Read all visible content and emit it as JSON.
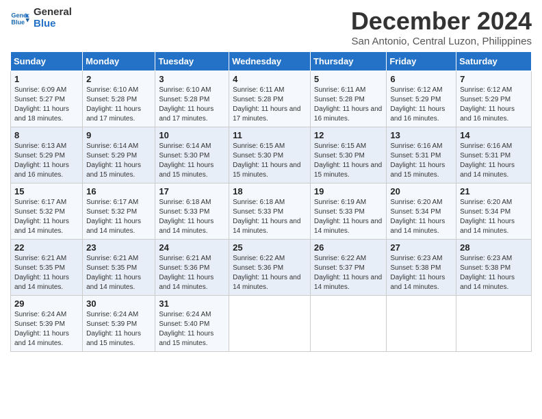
{
  "logo": {
    "line1": "General",
    "line2": "Blue"
  },
  "title": "December 2024",
  "subtitle": "San Antonio, Central Luzon, Philippines",
  "days_of_week": [
    "Sunday",
    "Monday",
    "Tuesday",
    "Wednesday",
    "Thursday",
    "Friday",
    "Saturday"
  ],
  "weeks": [
    [
      {
        "day": "1",
        "sunrise": "6:09 AM",
        "sunset": "5:27 PM",
        "daylight": "11 hours and 18 minutes."
      },
      {
        "day": "2",
        "sunrise": "6:10 AM",
        "sunset": "5:28 PM",
        "daylight": "11 hours and 17 minutes."
      },
      {
        "day": "3",
        "sunrise": "6:10 AM",
        "sunset": "5:28 PM",
        "daylight": "11 hours and 17 minutes."
      },
      {
        "day": "4",
        "sunrise": "6:11 AM",
        "sunset": "5:28 PM",
        "daylight": "11 hours and 17 minutes."
      },
      {
        "day": "5",
        "sunrise": "6:11 AM",
        "sunset": "5:28 PM",
        "daylight": "11 hours and 16 minutes."
      },
      {
        "day": "6",
        "sunrise": "6:12 AM",
        "sunset": "5:29 PM",
        "daylight": "11 hours and 16 minutes."
      },
      {
        "day": "7",
        "sunrise": "6:12 AM",
        "sunset": "5:29 PM",
        "daylight": "11 hours and 16 minutes."
      }
    ],
    [
      {
        "day": "8",
        "sunrise": "6:13 AM",
        "sunset": "5:29 PM",
        "daylight": "11 hours and 16 minutes."
      },
      {
        "day": "9",
        "sunrise": "6:14 AM",
        "sunset": "5:29 PM",
        "daylight": "11 hours and 15 minutes."
      },
      {
        "day": "10",
        "sunrise": "6:14 AM",
        "sunset": "5:30 PM",
        "daylight": "11 hours and 15 minutes."
      },
      {
        "day": "11",
        "sunrise": "6:15 AM",
        "sunset": "5:30 PM",
        "daylight": "11 hours and 15 minutes."
      },
      {
        "day": "12",
        "sunrise": "6:15 AM",
        "sunset": "5:30 PM",
        "daylight": "11 hours and 15 minutes."
      },
      {
        "day": "13",
        "sunrise": "6:16 AM",
        "sunset": "5:31 PM",
        "daylight": "11 hours and 15 minutes."
      },
      {
        "day": "14",
        "sunrise": "6:16 AM",
        "sunset": "5:31 PM",
        "daylight": "11 hours and 14 minutes."
      }
    ],
    [
      {
        "day": "15",
        "sunrise": "6:17 AM",
        "sunset": "5:32 PM",
        "daylight": "11 hours and 14 minutes."
      },
      {
        "day": "16",
        "sunrise": "6:17 AM",
        "sunset": "5:32 PM",
        "daylight": "11 hours and 14 minutes."
      },
      {
        "day": "17",
        "sunrise": "6:18 AM",
        "sunset": "5:33 PM",
        "daylight": "11 hours and 14 minutes."
      },
      {
        "day": "18",
        "sunrise": "6:18 AM",
        "sunset": "5:33 PM",
        "daylight": "11 hours and 14 minutes."
      },
      {
        "day": "19",
        "sunrise": "6:19 AM",
        "sunset": "5:33 PM",
        "daylight": "11 hours and 14 minutes."
      },
      {
        "day": "20",
        "sunrise": "6:20 AM",
        "sunset": "5:34 PM",
        "daylight": "11 hours and 14 minutes."
      },
      {
        "day": "21",
        "sunrise": "6:20 AM",
        "sunset": "5:34 PM",
        "daylight": "11 hours and 14 minutes."
      }
    ],
    [
      {
        "day": "22",
        "sunrise": "6:21 AM",
        "sunset": "5:35 PM",
        "daylight": "11 hours and 14 minutes."
      },
      {
        "day": "23",
        "sunrise": "6:21 AM",
        "sunset": "5:35 PM",
        "daylight": "11 hours and 14 minutes."
      },
      {
        "day": "24",
        "sunrise": "6:21 AM",
        "sunset": "5:36 PM",
        "daylight": "11 hours and 14 minutes."
      },
      {
        "day": "25",
        "sunrise": "6:22 AM",
        "sunset": "5:36 PM",
        "daylight": "11 hours and 14 minutes."
      },
      {
        "day": "26",
        "sunrise": "6:22 AM",
        "sunset": "5:37 PM",
        "daylight": "11 hours and 14 minutes."
      },
      {
        "day": "27",
        "sunrise": "6:23 AM",
        "sunset": "5:38 PM",
        "daylight": "11 hours and 14 minutes."
      },
      {
        "day": "28",
        "sunrise": "6:23 AM",
        "sunset": "5:38 PM",
        "daylight": "11 hours and 14 minutes."
      }
    ],
    [
      {
        "day": "29",
        "sunrise": "6:24 AM",
        "sunset": "5:39 PM",
        "daylight": "11 hours and 14 minutes."
      },
      {
        "day": "30",
        "sunrise": "6:24 AM",
        "sunset": "5:39 PM",
        "daylight": "11 hours and 15 minutes."
      },
      {
        "day": "31",
        "sunrise": "6:24 AM",
        "sunset": "5:40 PM",
        "daylight": "11 hours and 15 minutes."
      },
      null,
      null,
      null,
      null
    ]
  ],
  "labels": {
    "sunrise": "Sunrise:",
    "sunset": "Sunset:",
    "daylight": "Daylight:"
  }
}
